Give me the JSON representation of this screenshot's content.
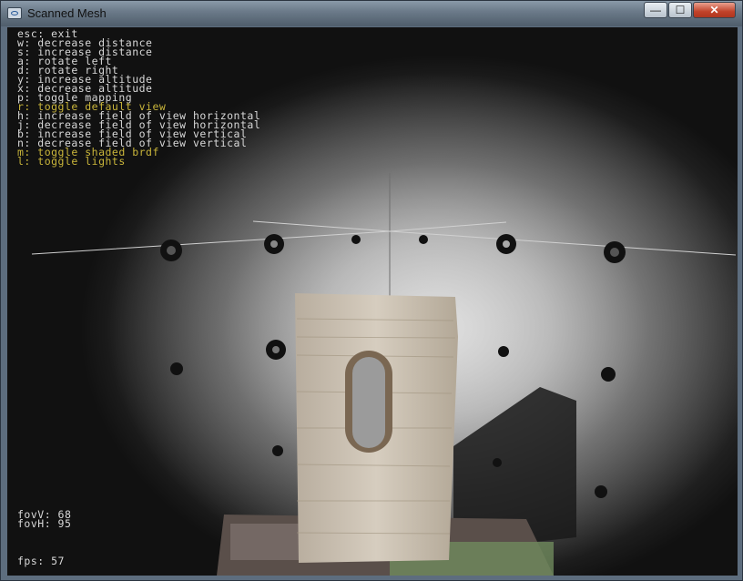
{
  "window": {
    "title": "Scanned Mesh"
  },
  "controls": {
    "minimize": "—",
    "maximize": "☐",
    "close": "✕"
  },
  "help": [
    {
      "text": "esc: exit",
      "color": "#d8d8d8"
    },
    {
      "text": "w: decrease distance",
      "color": "#d8d8d8"
    },
    {
      "text": "s: increase distance",
      "color": "#d8d8d8"
    },
    {
      "text": "a: rotate left",
      "color": "#d8d8d8"
    },
    {
      "text": "d: rotate right",
      "color": "#d8d8d8"
    },
    {
      "text": "y: increase altitude",
      "color": "#d8d8d8"
    },
    {
      "text": "x: decrease altitude",
      "color": "#d8d8d8"
    },
    {
      "text": "p: toggle mapping",
      "color": "#d8d8d8"
    },
    {
      "text": "r: toggle default view",
      "color": "#c9b53a"
    },
    {
      "text": "h: increase field of view horizontal",
      "color": "#d8d8d8"
    },
    {
      "text": "j: decrease field of view horizontal",
      "color": "#d8d8d8"
    },
    {
      "text": "b: increase field of view vertical",
      "color": "#d8d8d8"
    },
    {
      "text": "n: decrease field of view vertical",
      "color": "#d8d8d8"
    },
    {
      "text": "m: toggle shaded brdf",
      "color": "#c9b53a"
    },
    {
      "text": "l: toggle lights",
      "color": "#c9b53a"
    }
  ],
  "stats": {
    "fovV": "fovV: 68",
    "fovH": "fovH: 95",
    "fps": "fps: 57"
  }
}
